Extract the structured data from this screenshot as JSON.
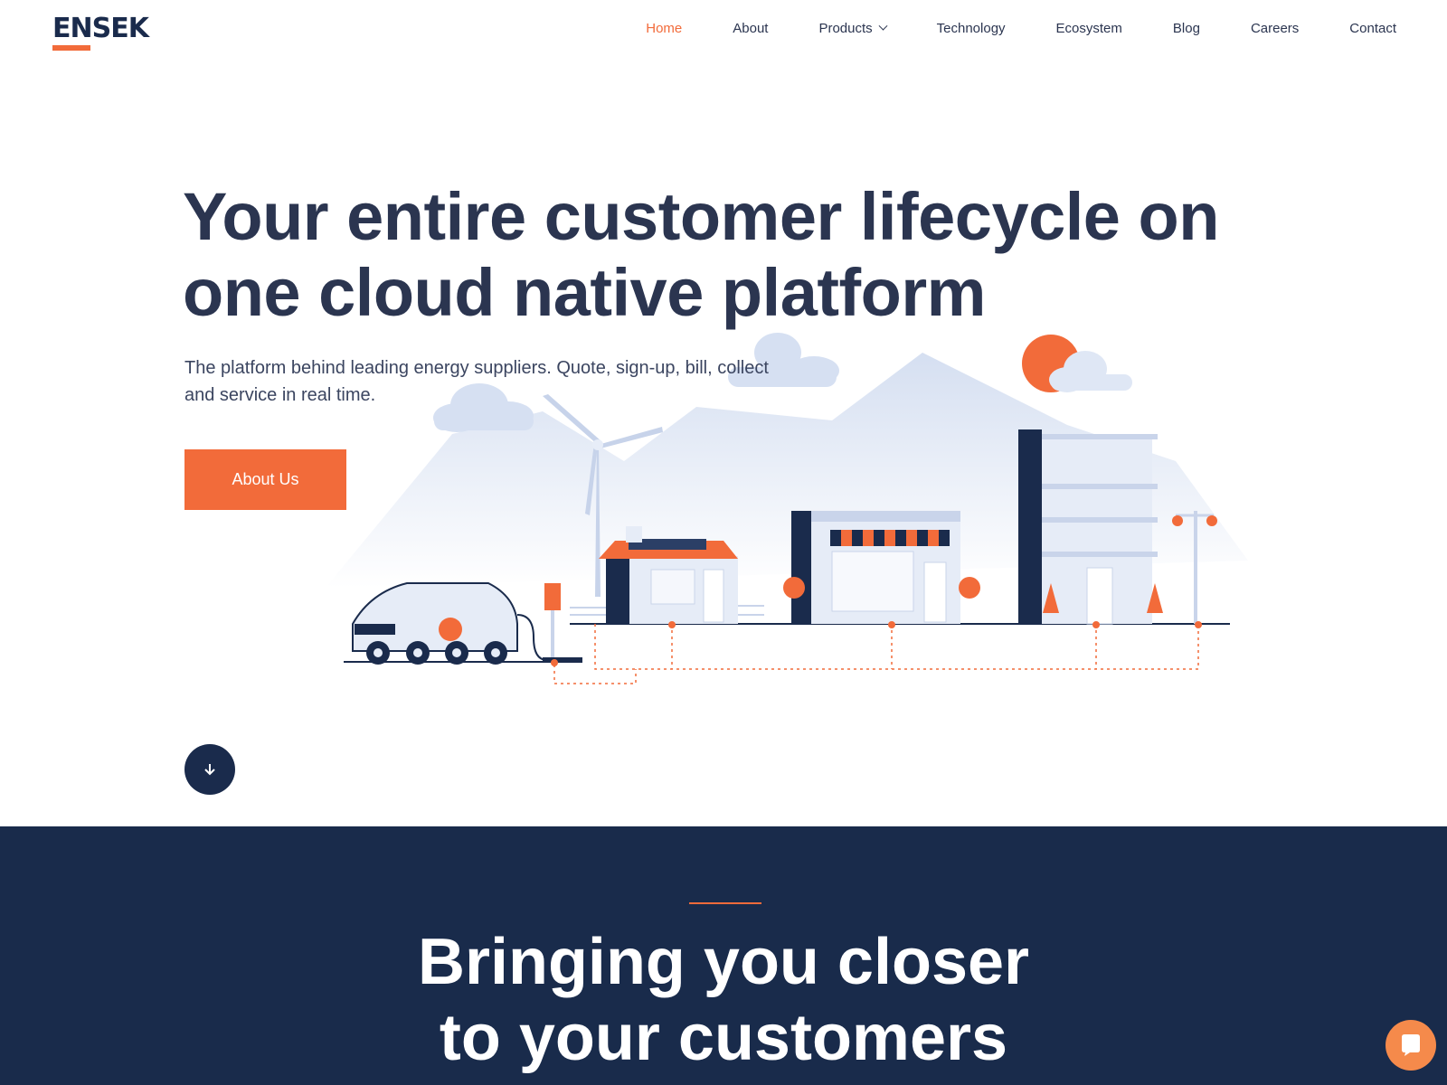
{
  "brand": {
    "logo_text": "ENSEK",
    "accent": "#f26b3a",
    "navy": "#1a2b4c",
    "dark_bg": "#192b4b"
  },
  "nav": {
    "items": [
      {
        "label": "Home",
        "active": true
      },
      {
        "label": "About"
      },
      {
        "label": "Products",
        "has_dropdown": true
      },
      {
        "label": "Technology"
      },
      {
        "label": "Ecosystem"
      },
      {
        "label": "Blog"
      },
      {
        "label": "Careers"
      },
      {
        "label": "Contact"
      }
    ]
  },
  "hero": {
    "title_line1": "Your entire customer lifecycle on",
    "title_line2": "one cloud native platform",
    "subtitle_line1": "The platform behind leading energy suppliers. Quote, sign-up, bill, collect",
    "subtitle_line2": "and service in real time.",
    "cta_label": "About Us",
    "scroll_icon": "arrow-down-icon"
  },
  "section2": {
    "title_line1": "Bringing you closer",
    "title_line2": "to your customers"
  },
  "chat": {
    "icon": "chat-bubble-icon"
  }
}
